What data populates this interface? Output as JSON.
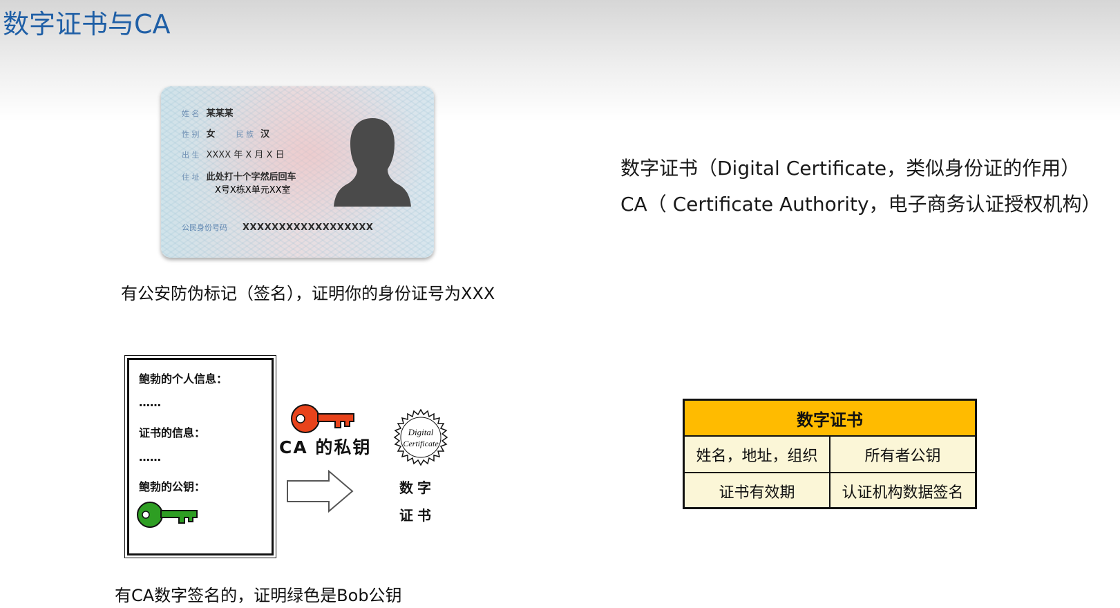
{
  "title": "数字证书与CA",
  "id_card": {
    "name_label": "姓 名",
    "name_value": "某某某",
    "gender_label": "性 别",
    "gender_value": "女",
    "ethnic_label": "民 族",
    "ethnic_value": "汉",
    "birth_label": "出 生",
    "birth_value": "XXXX 年 X 月 X 日",
    "address_label": "住 址",
    "address_line1": "此处打十个字然后回车",
    "address_line2": "X号X栋X单元XX室",
    "id_label": "公民身份号码",
    "id_value": "XXXXXXXXXXXXXXXXXX"
  },
  "id_caption": "有公安防伪标记（签名），证明你的身份证号为XXX",
  "definitions": {
    "line1": "数字证书（Digital Certificate，类似身份证的作用）",
    "line2": "CA（ Certificate Authority，电子商务认证授权机构）"
  },
  "document": {
    "line1": "鲍勃的个人信息：",
    "dots1": "……",
    "line2": "证书的信息：",
    "dots2": "……",
    "line3": "鲍勃的公钥："
  },
  "ca_key_label": "CA 的私钥",
  "seal": {
    "top": "Digital",
    "bottom": "Certificate"
  },
  "cert_label_top": "数字",
  "cert_label_bottom": "证书",
  "doc_caption": "有CA数字签名的，证明绿色是Bob公钥",
  "table": {
    "header": "数字证书",
    "rows": [
      [
        "姓名，地址，组织",
        "所有者公钥"
      ],
      [
        "证书有效期",
        "认证机构数据签名"
      ]
    ]
  },
  "colors": {
    "title": "#1f5fa6",
    "table_header": "#ffbb00",
    "table_body": "#fbf6d7",
    "ca_key": "#e8431b",
    "bob_key": "#2e9e23"
  }
}
